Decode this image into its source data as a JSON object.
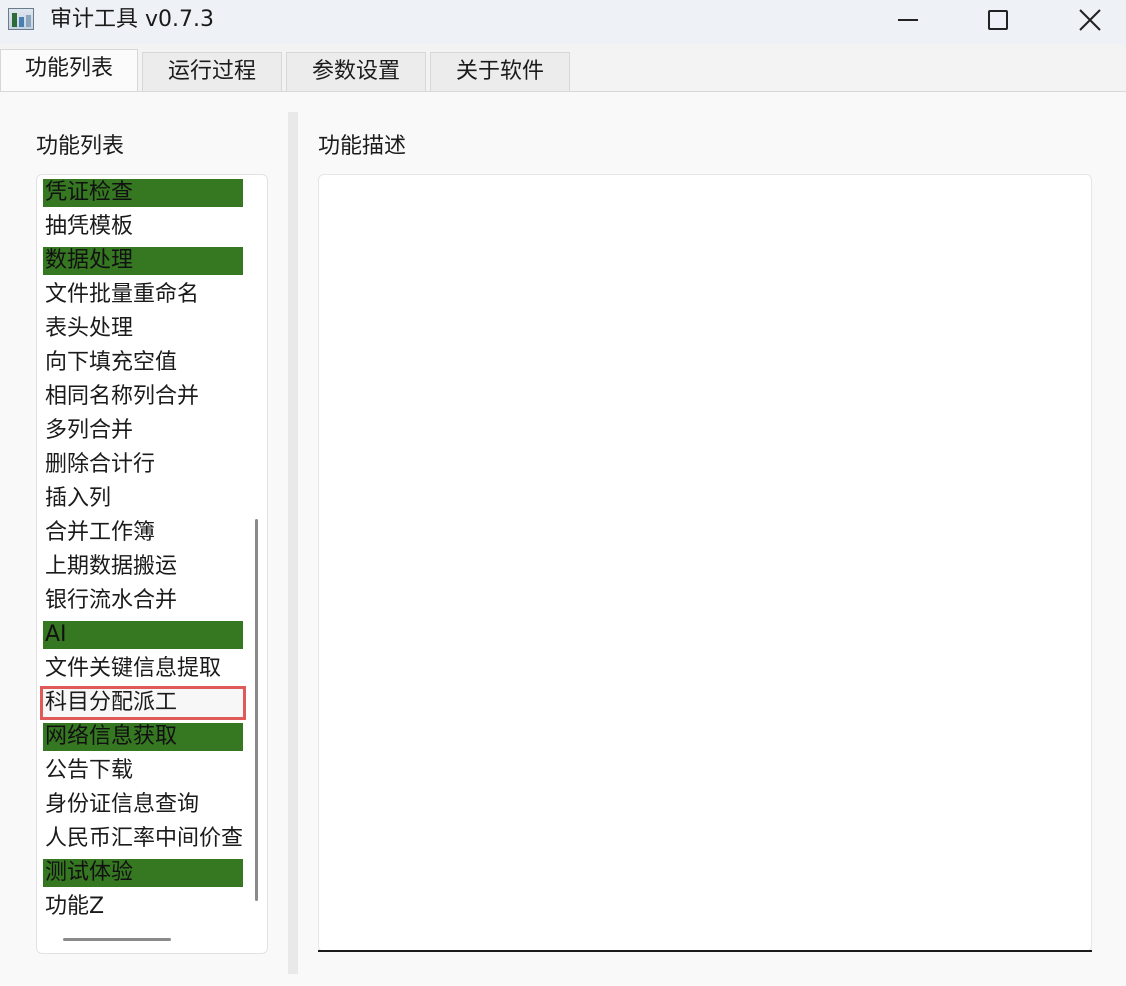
{
  "window": {
    "title": "审计工具 v0.7.3"
  },
  "tabs": [
    {
      "label": "功能列表",
      "active": true
    },
    {
      "label": "运行过程",
      "active": false
    },
    {
      "label": "参数设置",
      "active": false
    },
    {
      "label": "关于软件",
      "active": false
    }
  ],
  "left": {
    "heading": "功能列表",
    "items": [
      {
        "label": "凭证检查",
        "category": true
      },
      {
        "label": "抽凭模板",
        "category": false
      },
      {
        "label": "数据处理",
        "category": true
      },
      {
        "label": "文件批量重命名",
        "category": false
      },
      {
        "label": "表头处理",
        "category": false
      },
      {
        "label": "向下填充空值",
        "category": false
      },
      {
        "label": "相同名称列合并",
        "category": false
      },
      {
        "label": "多列合并",
        "category": false
      },
      {
        "label": "删除合计行",
        "category": false
      },
      {
        "label": "插入列",
        "category": false
      },
      {
        "label": "合并工作簿",
        "category": false
      },
      {
        "label": "上期数据搬运",
        "category": false
      },
      {
        "label": "银行流水合并",
        "category": false
      },
      {
        "label": "AI",
        "category": true
      },
      {
        "label": "文件关键信息提取",
        "category": false
      },
      {
        "label": "科目分配派工",
        "category": false,
        "selected": true
      },
      {
        "label": "网络信息获取",
        "category": true
      },
      {
        "label": "公告下载",
        "category": false
      },
      {
        "label": "身份证信息查询",
        "category": false
      },
      {
        "label": "人民币汇率中间价查",
        "category": false
      },
      {
        "label": "测试体验",
        "category": true
      },
      {
        "label": "功能Z",
        "category": false
      }
    ]
  },
  "right": {
    "heading": "功能描述",
    "description": ""
  },
  "icons": {
    "app": "app-chart-icon",
    "minimize": "minimize-icon",
    "maximize": "maximize-icon",
    "close": "close-icon"
  },
  "colors": {
    "category_bg": "#367722",
    "selection_outline": "#e05a5a"
  }
}
